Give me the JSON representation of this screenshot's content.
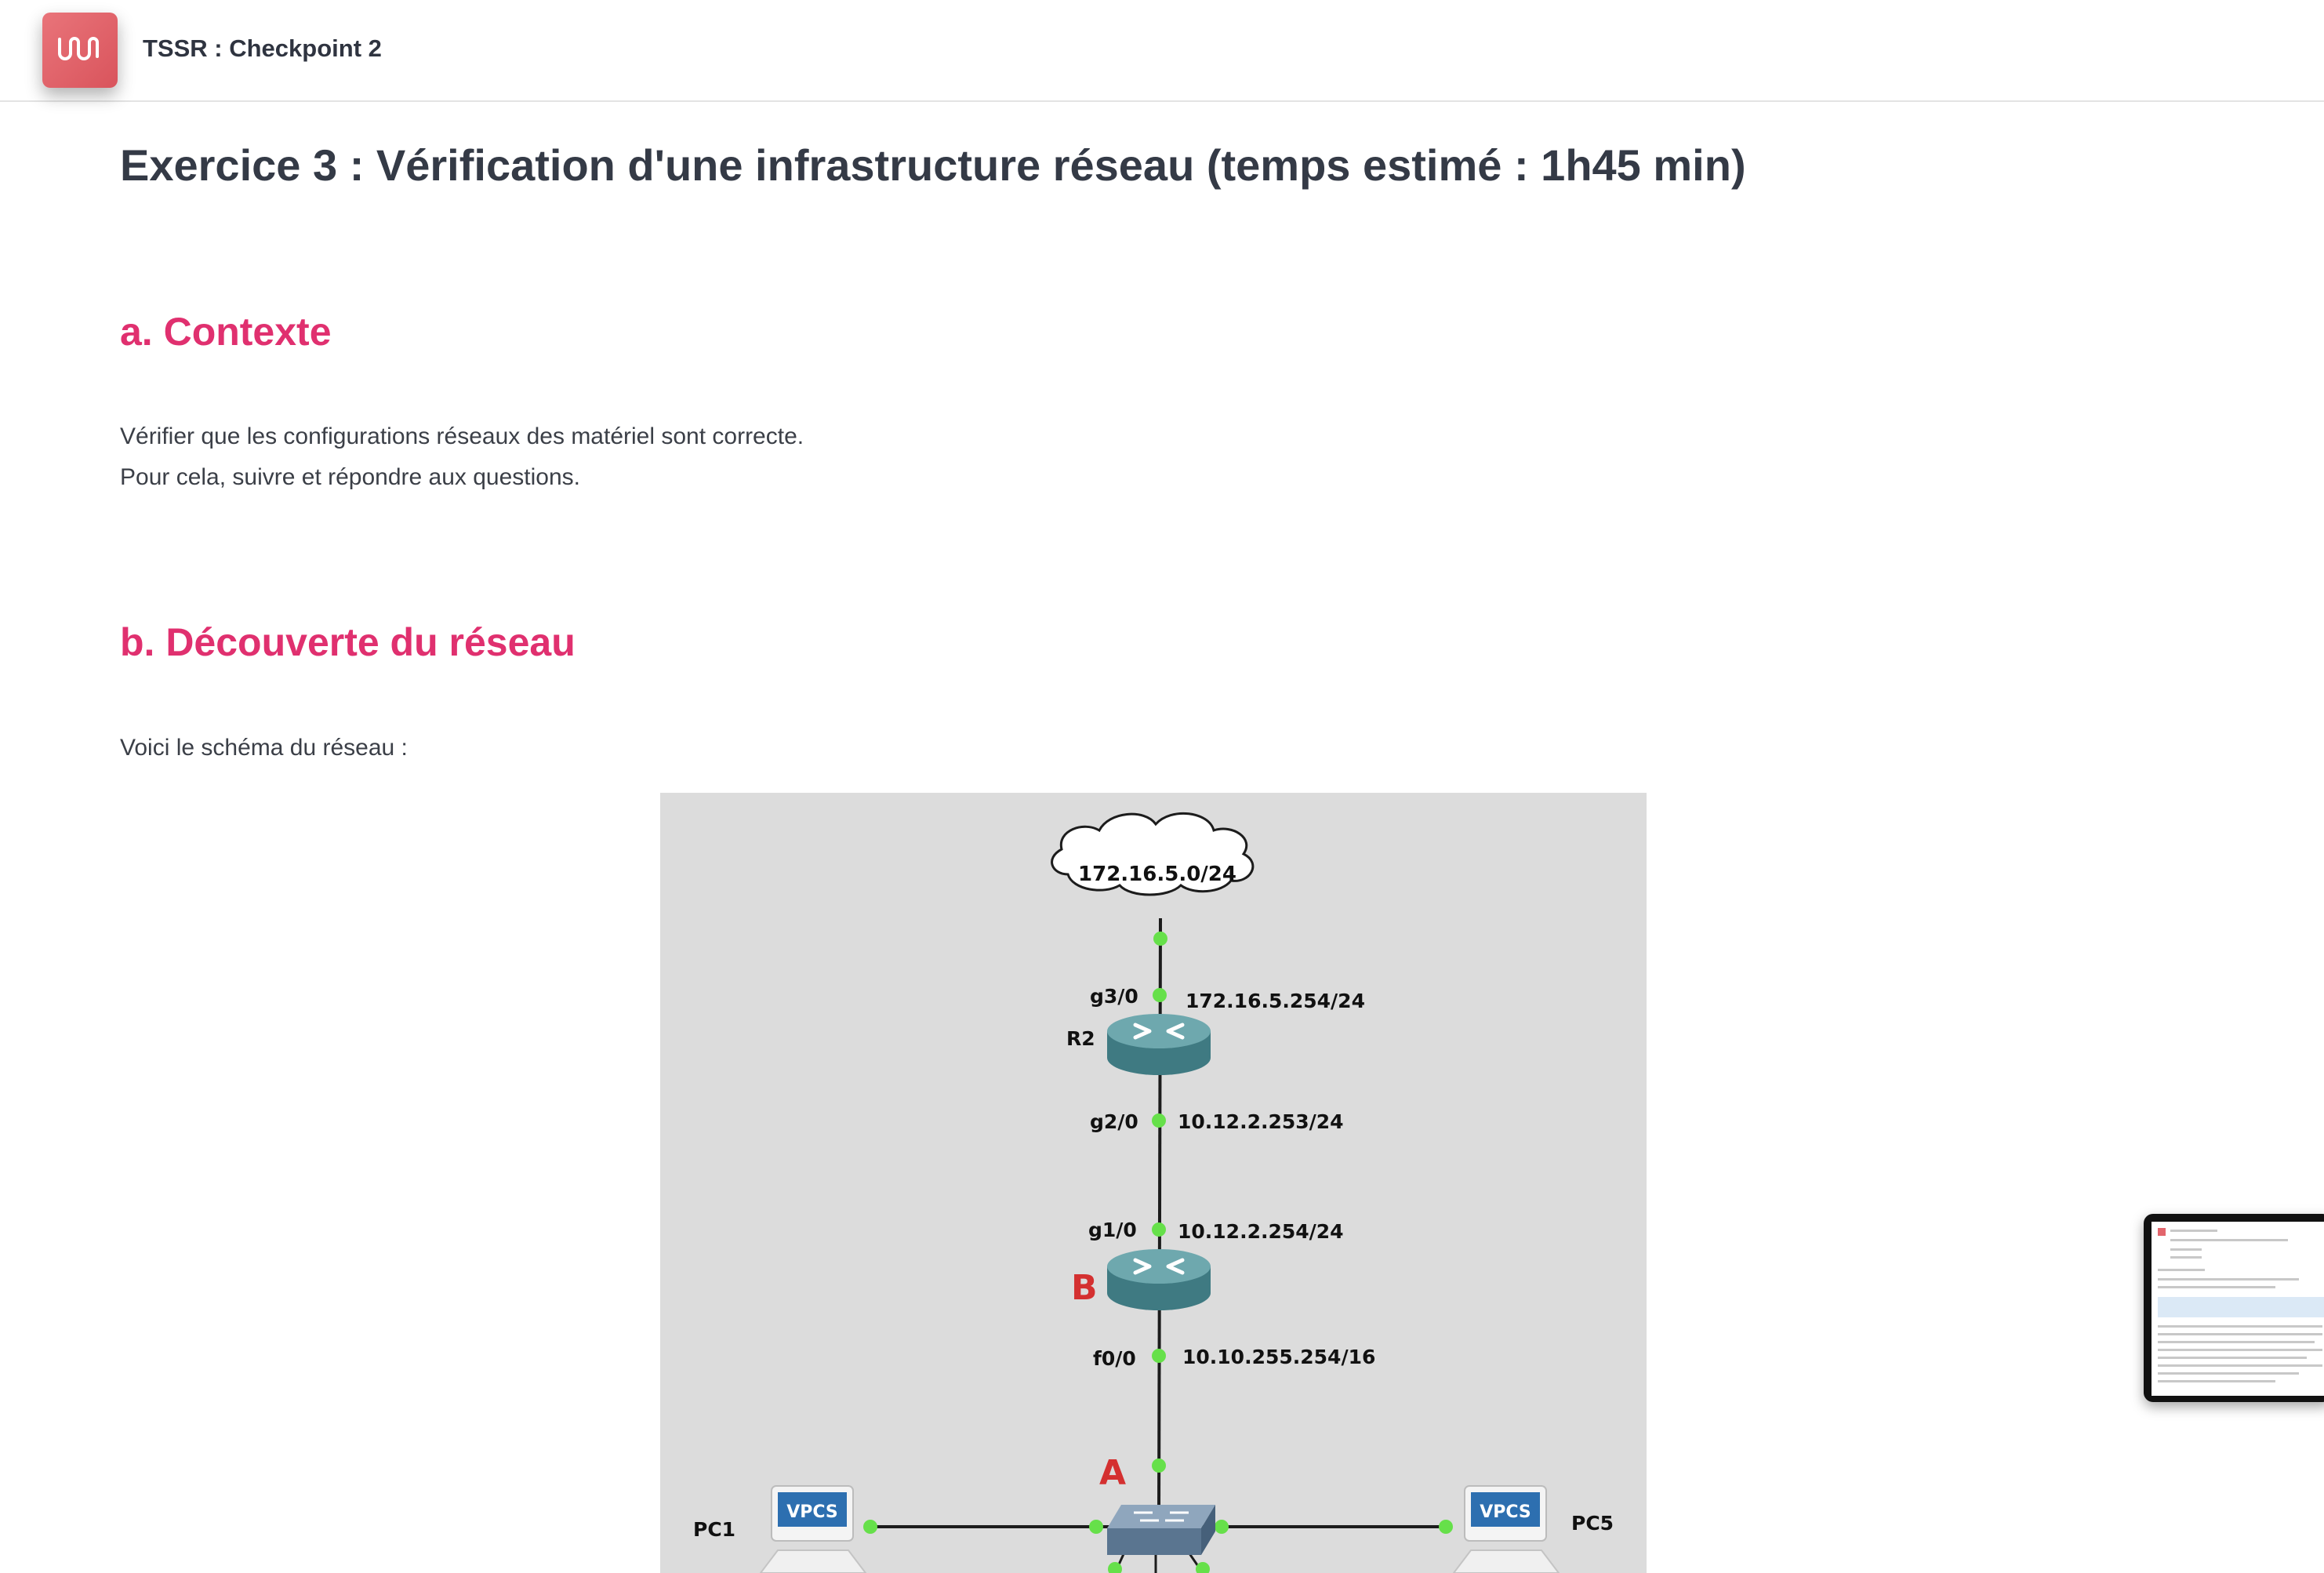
{
  "app": {
    "title": "TSSR : Checkpoint 2"
  },
  "page": {
    "title": "Exercice 3 : Vérification d'une infrastructure réseau (temps estimé : 1h45 min)",
    "sections": [
      {
        "heading": "a. Contexte",
        "paragraphs": [
          "Vérifier que les configurations réseaux des matériel sont correcte.",
          "Pour cela, suivre et répondre aux questions."
        ]
      },
      {
        "heading": "b. Découverte du réseau",
        "paragraphs": [
          "Voici le schéma du réseau :"
        ]
      }
    ]
  },
  "diagram": {
    "cloud_label": "172.16.5.0/24",
    "router_top": {
      "name": "R2",
      "iface_top": "g3/0",
      "ip_top": "172.16.5.254/24",
      "iface_bottom": "g2/0",
      "ip_bottom": "10.12.2.253/24"
    },
    "router_mid": {
      "name": "B",
      "iface_top": "g1/0",
      "ip_top": "10.12.2.254/24",
      "iface_bottom": "f0/0",
      "ip_bottom": "10.10.255.254/16"
    },
    "switch_label": "A",
    "pc_left": {
      "name": "PC1",
      "badge": "VPCS"
    },
    "pc_right": {
      "name": "PC5",
      "badge": "VPCS"
    }
  },
  "colors": {
    "accent": "#e0306f",
    "logo": "#e2656c",
    "diagram_bg": "#dcdcdc",
    "link_dot": "#66e04a",
    "annotation_red": "#d43030",
    "router": "#4e8e95"
  },
  "icons": {
    "logo": "wave-logo-icon",
    "router": "router-icon",
    "switch": "switch-icon",
    "cloud": "cloud-icon",
    "pc": "vpcs-computer-icon"
  }
}
